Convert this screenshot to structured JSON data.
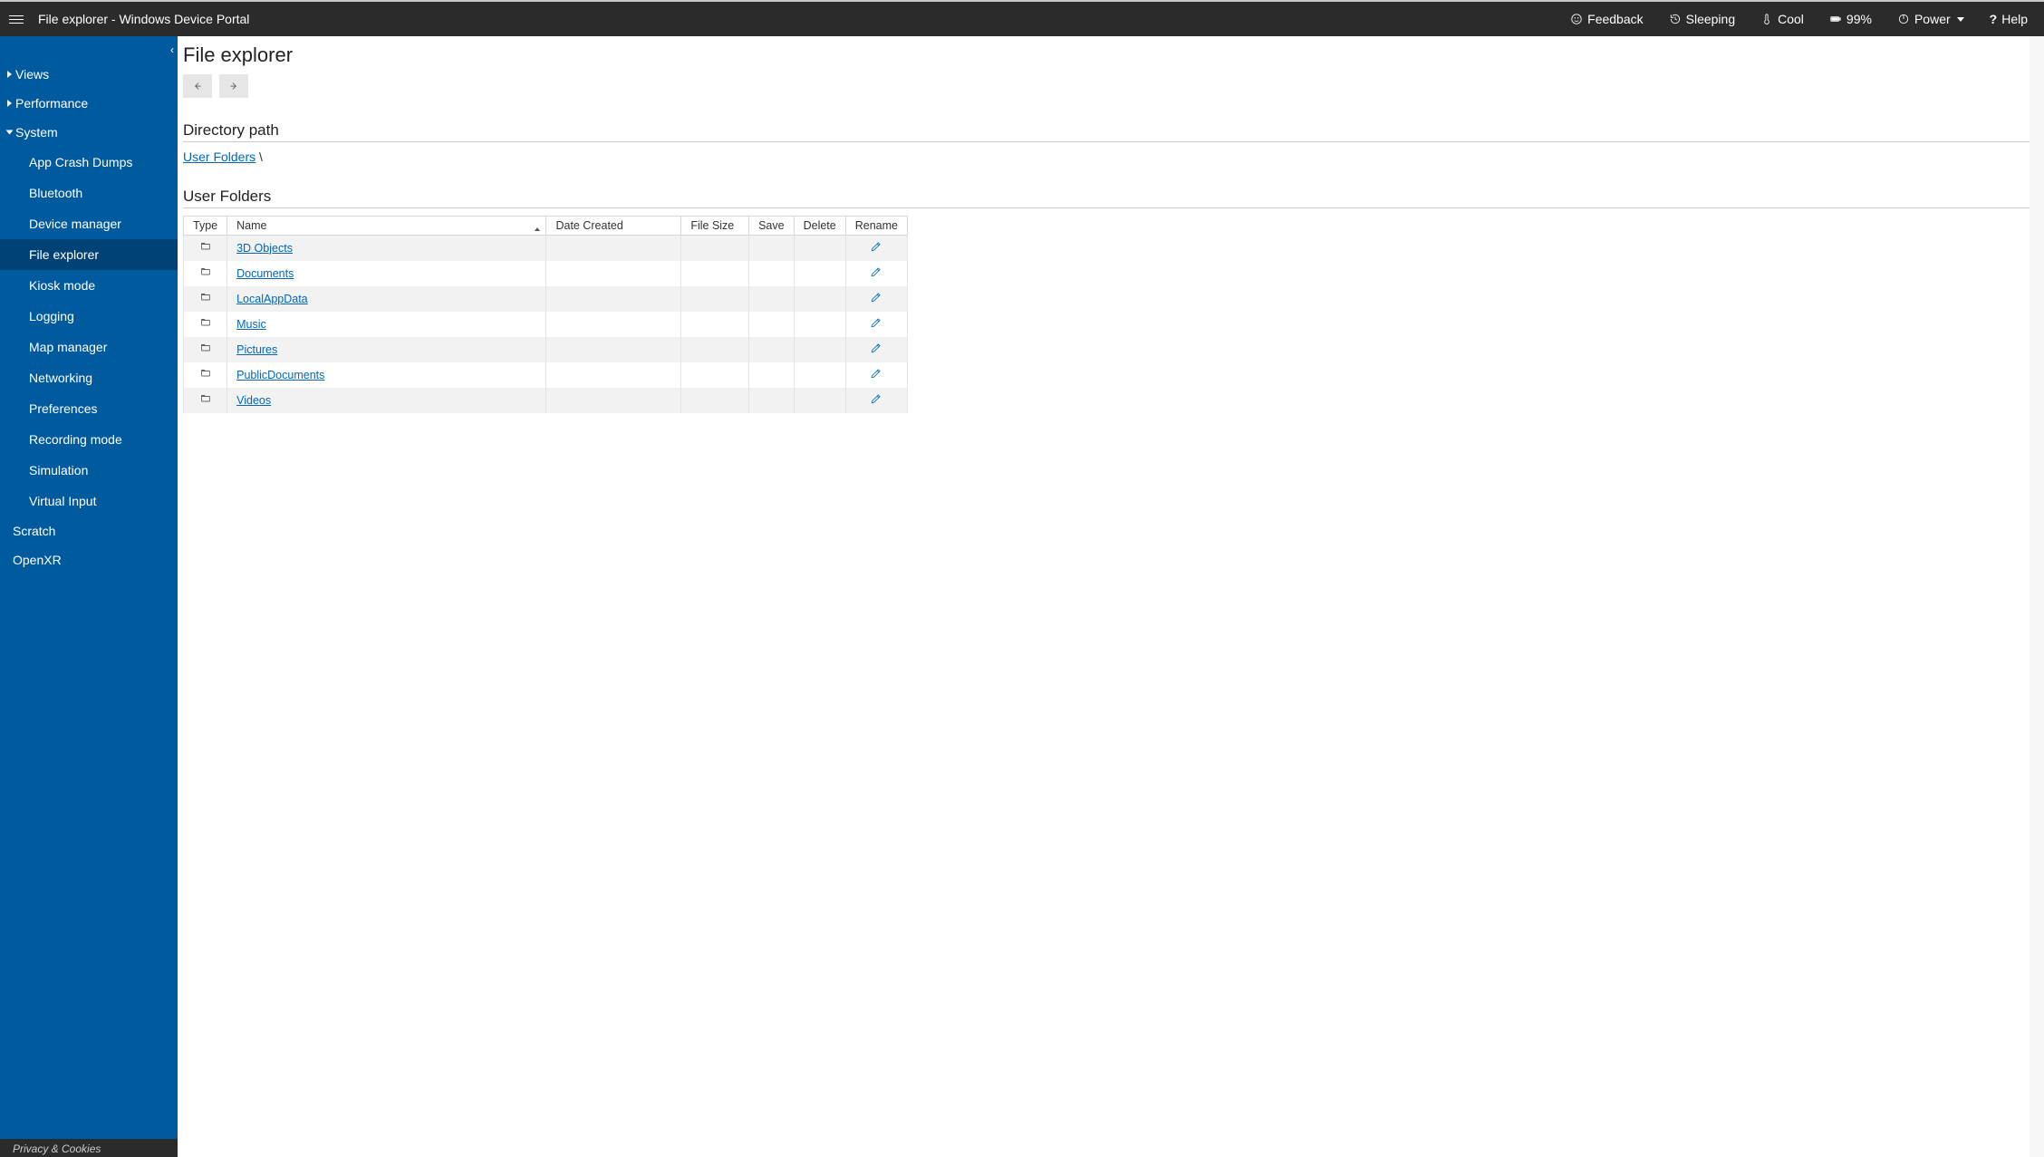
{
  "header": {
    "title": "File explorer - Windows Device Portal",
    "feedback": "Feedback",
    "sleeping": "Sleeping",
    "cool": "Cool",
    "battery": "99%",
    "power": "Power",
    "help": "Help"
  },
  "sidebar": {
    "views": "Views",
    "performance": "Performance",
    "system": "System",
    "system_children": {
      "app_crash_dumps": "App Crash Dumps",
      "bluetooth": "Bluetooth",
      "device_manager": "Device manager",
      "file_explorer": "File explorer",
      "kiosk_mode": "Kiosk mode",
      "logging": "Logging",
      "map_manager": "Map manager",
      "networking": "Networking",
      "preferences": "Preferences",
      "recording_mode": "Recording mode",
      "simulation": "Simulation",
      "virtual_input": "Virtual Input"
    },
    "scratch": "Scratch",
    "openxr": "OpenXR",
    "footer": "Privacy & Cookies"
  },
  "page": {
    "heading": "File explorer",
    "dir_path_heading": "Directory path",
    "breadcrumb_root": "User Folders",
    "breadcrumb_sep": " \\",
    "table_heading": "User Folders"
  },
  "columns": {
    "type": "Type",
    "name": "Name",
    "date": "Date Created",
    "size": "File Size",
    "save": "Save",
    "delete": "Delete",
    "rename": "Rename"
  },
  "rows": {
    "r0": "3D Objects",
    "r1": "Documents",
    "r2": "LocalAppData",
    "r3": "Music",
    "r4": "Pictures",
    "r5": "PublicDocuments",
    "r6": "Videos"
  }
}
